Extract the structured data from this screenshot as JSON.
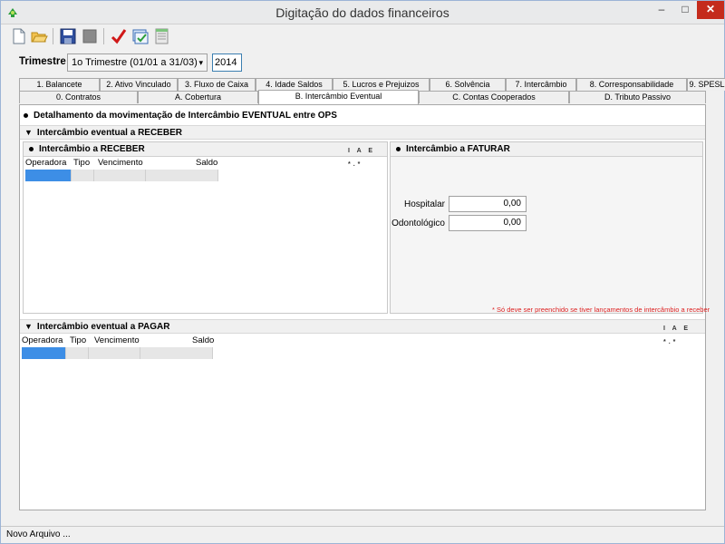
{
  "window": {
    "title": "Digitação do dados financeiros",
    "min": "–",
    "max": "□",
    "close": "✕"
  },
  "toolbar": {
    "buttons": [
      "new-file-icon",
      "open-folder-icon",
      "save-icon",
      "disabled-save-icon",
      "check-icon",
      "validate-icon",
      "report-icon"
    ]
  },
  "filter": {
    "label": "Trimestre",
    "quarter": "1o Trimestre (01/01 a 31/03)",
    "year": "2014"
  },
  "tabs_row1": [
    "1. Balancete",
    "2. Ativo Vinculado",
    "3. Fluxo de Caixa",
    "4. Idade Saldos",
    "5. Lucros e Prejuizos",
    "6. Solvência",
    "7. Intercâmbio",
    "8. Corresponsabilidade",
    "9. SPESL"
  ],
  "tabs_row2": [
    "0. Contratos",
    "A. Cobertura",
    "B. Intercâmbio Eventual",
    "C. Contas Cooperados",
    "D. Tributo Passivo"
  ],
  "content": {
    "heading": "Detalhamento da movimentação de Intercâmbio EVENTUAL entre OPS",
    "receber_section": "Intercâmbio eventual a RECEBER",
    "receber_panel": "Intercâmbio a RECEBER",
    "faturar_panel": "Intercâmbio a FATURAR",
    "pagar_section": "Intercâmbio eventual a PAGAR",
    "mini_tools": "I A E *.*",
    "columns": [
      "Operadora",
      "Tipo",
      "Vencimento",
      "Saldo"
    ],
    "hospitalar_label": "Hospitalar",
    "hospitalar_value": "0,00",
    "odonto_label": "Odontológico",
    "odonto_value": "0,00",
    "note": "* Só deve ser preenchido se tiver lançamentos de intercâmbio a receber"
  },
  "status": "Novo Arquivo ..."
}
